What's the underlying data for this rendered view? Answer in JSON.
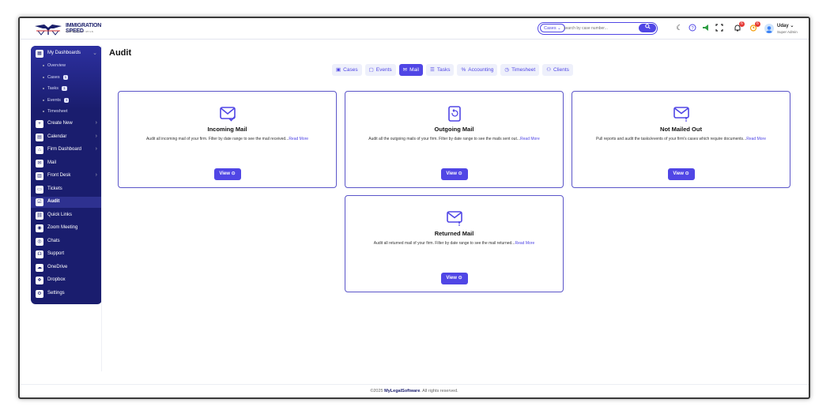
{
  "brand": {
    "name": "IMMIGRATION SPEED",
    "tagline": "POWERED BY MYLS"
  },
  "search": {
    "category": "Cases ⌄",
    "placeholder": "search by case number..."
  },
  "notifications": {
    "bell_count": "6",
    "alert_count": "6"
  },
  "user": {
    "name": "Uday ⌄",
    "role": "Super Admin"
  },
  "sidebar": {
    "my_dashboards": "My Dashboards",
    "subitems": [
      {
        "label": "Overview",
        "count": ""
      },
      {
        "label": "Cases",
        "count": "1"
      },
      {
        "label": "Tasks",
        "count": "1"
      },
      {
        "label": "Events",
        "count": "1"
      },
      {
        "label": "Timesheet",
        "count": ""
      }
    ],
    "items": [
      {
        "label": "Create New",
        "icon": "plus-icon"
      },
      {
        "label": "Calendar",
        "icon": "calendar-icon"
      },
      {
        "label": "Firm Dashboard",
        "icon": "firm-icon"
      },
      {
        "label": "Mail",
        "icon": "mail-icon"
      },
      {
        "label": "Front Desk",
        "icon": "desk-icon"
      },
      {
        "label": "Tickets",
        "icon": "ticket-icon"
      },
      {
        "label": "Audit",
        "icon": "audit-icon"
      },
      {
        "label": "Quick Links",
        "icon": "link-icon"
      },
      {
        "label": "Zoom Meeting",
        "icon": "video-icon"
      },
      {
        "label": "Chats",
        "icon": "chat-icon"
      },
      {
        "label": "Support",
        "icon": "support-icon"
      },
      {
        "label": "OneDrive",
        "icon": "cloud-icon"
      },
      {
        "label": "Dropbox",
        "icon": "dropbox-icon"
      },
      {
        "label": "Settings",
        "icon": "gear-icon"
      }
    ]
  },
  "page": {
    "title": "Audit"
  },
  "tabs": [
    {
      "label": "Cases",
      "icon": "briefcase-icon"
    },
    {
      "label": "Events",
      "icon": "calendar-icon"
    },
    {
      "label": "Mail",
      "icon": "mail-icon"
    },
    {
      "label": "Tasks",
      "icon": "list-icon"
    },
    {
      "label": "Accounting",
      "icon": "percent-icon"
    },
    {
      "label": "Timesheet",
      "icon": "clock-icon"
    },
    {
      "label": "Clients",
      "icon": "users-icon"
    }
  ],
  "cards": [
    {
      "title": "Incoming Mail",
      "desc": "Audit all incoming mail of your firm. Filter by date range to see the mail received...",
      "more": "Read More",
      "button": "View ⊙"
    },
    {
      "title": "Outgoing Mail",
      "desc": "Audit all the outgoing mails of your firm. Filter by date range to see the mails sent out...",
      "more": "Read More",
      "button": "View ⊙"
    },
    {
      "title": "Not Mailed Out",
      "desc": "Pull reports and audit the tasks/events of your firm's cases which require documents...",
      "more": "Read More",
      "button": "View ⊙"
    },
    {
      "title": "Returned Mail",
      "desc": "Audit all returned mail of your firm. Filter by date range to see the mail returned...",
      "more": "Read More",
      "button": "View ⊙"
    }
  ],
  "footer": {
    "prefix": "©2025 ",
    "brand": "MyLegalSoftware",
    "suffix": ". All rights reserved."
  },
  "colors": {
    "accent": "#5046e5",
    "sidebar": "#1a1d6e"
  }
}
